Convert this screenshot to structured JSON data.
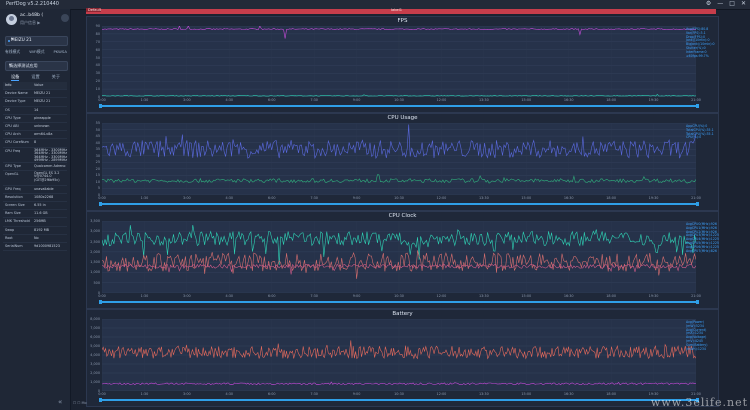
{
  "window": {
    "title": "PerfDog v5.2.210440",
    "buttons": [
      "⚙",
      "—",
      "□",
      "✕"
    ]
  },
  "sidebar": {
    "user": {
      "name": "ac..b48b (",
      "sub": "用户信息 ▶"
    },
    "device": "MEIZU 21",
    "modes": [
      "有线模式",
      "WiFi模式",
      "PKWSA"
    ],
    "app": "请选择测试应用",
    "tabs": [
      "设备",
      "设置",
      "关于"
    ],
    "table": {
      "headers": [
        "Info",
        "Value"
      ],
      "rows": [
        [
          "Device Name",
          "MEIZU 21"
        ],
        [
          "Device Type",
          "MEIZU 21"
        ],
        [
          "OS",
          "14"
        ],
        [
          "CPU Type",
          "pineapple"
        ],
        [
          "CPU ABI",
          "unknown"
        ],
        [
          "CPU Arch",
          "arm64-v8a"
        ],
        [
          "CPU CoreNum",
          "8"
        ],
        [
          "CPU Freq",
          "364MHz - 3300MHz 364MHz - 3300MHz 364MHz - 3300MHz 499MHz - 2899MHz"
        ],
        [
          "GPU Type",
          "Qualcomm Adreno 750 (TM)"
        ],
        [
          "OpenGL",
          "OpenGL ES 3.2 V@0744.0 (GIT@2f6b95c)"
        ],
        [
          "GPU Freq",
          "unavailable"
        ],
        [
          "Resolution",
          "1080x2268"
        ],
        [
          "Screen Size",
          "6.55 in"
        ],
        [
          "Ram Size",
          "11.6 GB"
        ],
        [
          "LMK Threshold",
          "256MB"
        ],
        [
          "Swap",
          "8192 MB"
        ],
        [
          "Root",
          "No"
        ],
        [
          "SerialNum",
          "9d1000981523"
        ]
      ]
    },
    "collapse_icon": "«"
  },
  "labelbar": {
    "left": "Default",
    "center": "label1"
  },
  "panels": [
    {
      "title": "FPS",
      "yticks": [
        "90",
        "80",
        "70",
        "60",
        "50",
        "40",
        "30",
        "20",
        "10",
        "0"
      ],
      "legend": [
        "Avg(FPS):80.8",
        "Var(FPS):3.1",
        "Drop(FPS):0",
        "Jank(/10min):0",
        "BigJank(/10min):0",
        "Stutter(%):0",
        "InterFrame:0",
        "≥60fps:99.7%"
      ],
      "legend_color": "#3da3ff"
    },
    {
      "title": "CPU Usage",
      "yticks": [
        "55",
        "50",
        "45",
        "40",
        "35",
        "30",
        "25",
        "20",
        "15",
        "10",
        "5",
        "0"
      ],
      "legend": [
        "AppCPU(%):0",
        "TotalCPU(%):35.1",
        "TotalCPU(%):35.1",
        "CPU(%):0"
      ],
      "legend_color": "#3da3ff"
    },
    {
      "title": "CPU Clock",
      "yticks": [
        "3,500",
        "3,000",
        "2,500",
        "2,000",
        "1,500",
        "1,000",
        "500",
        "0"
      ],
      "legend": [
        "AvgCPU0(MHz):926",
        "AvgCPU1(MHz):926",
        "AvgCPU2(MHz):926",
        "AvgCPU3(MHz):1225",
        "AvgCPU4(MHz):1225",
        "AvgCPU5(MHz):1225",
        "AvgCPU6(MHz):1225",
        "AvgCPU7(MHz):826"
      ],
      "legend_color": "#3da3ff"
    },
    {
      "title": "Battery",
      "yticks": [
        "8,000",
        "7,000",
        "6,000",
        "5,000",
        "4,000",
        "3,000",
        "2,000",
        "1,000",
        "0"
      ],
      "legend": [
        "Avg(Power)(mW):5234",
        "Avg(Current)(mA):1234",
        "Avg(Voltage)(mV):4245",
        "Sum(Battery)(mWh):1234"
      ],
      "legend_color": "#3da3ff"
    }
  ],
  "xticks": [
    "0:00",
    "1:30",
    "3:00",
    "4:30",
    "6:00",
    "7:30",
    "9:00",
    "10:30",
    "12:00",
    "13:30",
    "15:00",
    "16:30",
    "18:00",
    "19:30",
    "21:00"
  ],
  "status": "☐ ☐ Mo",
  "watermark": "www.3elife.net"
}
